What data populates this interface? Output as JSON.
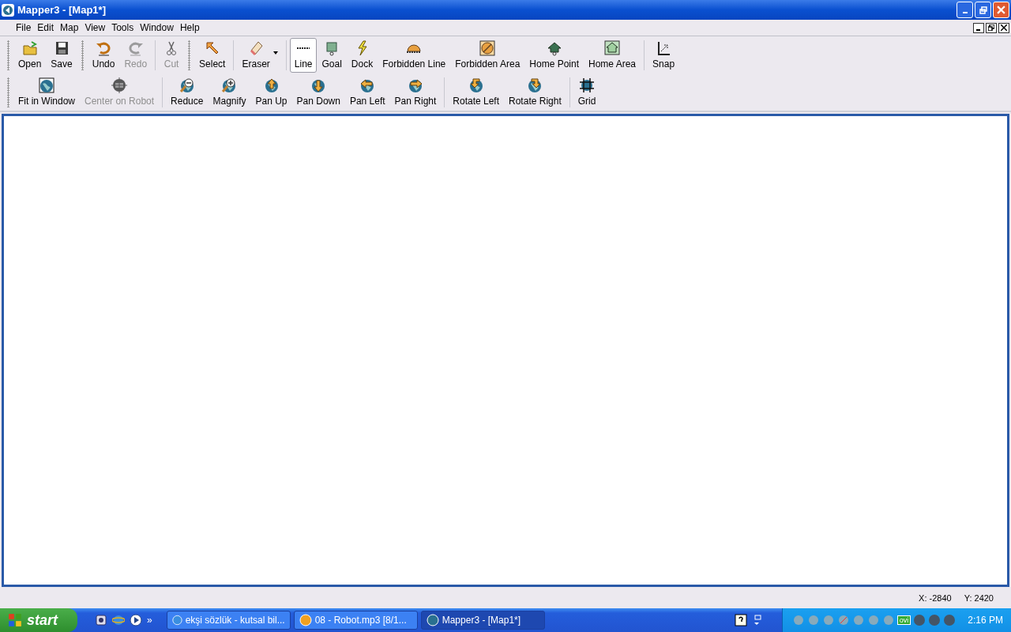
{
  "window": {
    "title": "Mapper3 - [Map1*]"
  },
  "menu": [
    "File",
    "Edit",
    "Map",
    "View",
    "Tools",
    "Window",
    "Help"
  ],
  "toolbar_1": [
    {
      "label": "Open",
      "disabled": false,
      "selected": false
    },
    {
      "label": "Save",
      "disabled": false,
      "selected": false
    },
    {
      "label": "Undo",
      "disabled": false,
      "selected": false
    },
    {
      "label": "Redo",
      "disabled": true,
      "selected": false
    },
    {
      "label": "Cut",
      "disabled": true,
      "selected": false
    },
    {
      "label": "Select",
      "disabled": false,
      "selected": false
    },
    {
      "label": "Eraser",
      "disabled": false,
      "selected": false
    },
    {
      "label": "Line",
      "disabled": false,
      "selected": true
    },
    {
      "label": "Goal",
      "disabled": false,
      "selected": false
    },
    {
      "label": "Dock",
      "disabled": false,
      "selected": false
    },
    {
      "label": "Forbidden Line",
      "disabled": false,
      "selected": false
    },
    {
      "label": "Forbidden Area",
      "disabled": false,
      "selected": false
    },
    {
      "label": "Home Point",
      "disabled": false,
      "selected": false
    },
    {
      "label": "Home Area",
      "disabled": false,
      "selected": false
    },
    {
      "label": "Snap",
      "disabled": false,
      "selected": false
    }
  ],
  "toolbar_2": [
    {
      "label": "Fit in Window",
      "disabled": false
    },
    {
      "label": "Center on Robot",
      "disabled": true
    },
    {
      "label": "Reduce",
      "disabled": false
    },
    {
      "label": "Magnify",
      "disabled": false
    },
    {
      "label": "Pan Up",
      "disabled": false
    },
    {
      "label": "Pan Down",
      "disabled": false
    },
    {
      "label": "Pan Left",
      "disabled": false
    },
    {
      "label": "Pan Right",
      "disabled": false
    },
    {
      "label": "Rotate Left",
      "disabled": false
    },
    {
      "label": "Rotate Right",
      "disabled": false
    },
    {
      "label": "Grid",
      "disabled": false
    }
  ],
  "status_bar": {
    "x": "X: -2840",
    "y": "Y: 2420"
  },
  "taskbar": {
    "start": "start",
    "quick_launch_more": "»",
    "buttons": [
      {
        "label": "ekşi sözlük - kutsal bil...",
        "selected": false
      },
      {
        "label": "08 - Robot.mp3  [8/1...",
        "selected": false
      },
      {
        "label": "Mapper3 - [Map1*]",
        "selected": true
      }
    ],
    "tray_label": "ovi",
    "clock": "2:16 PM"
  }
}
